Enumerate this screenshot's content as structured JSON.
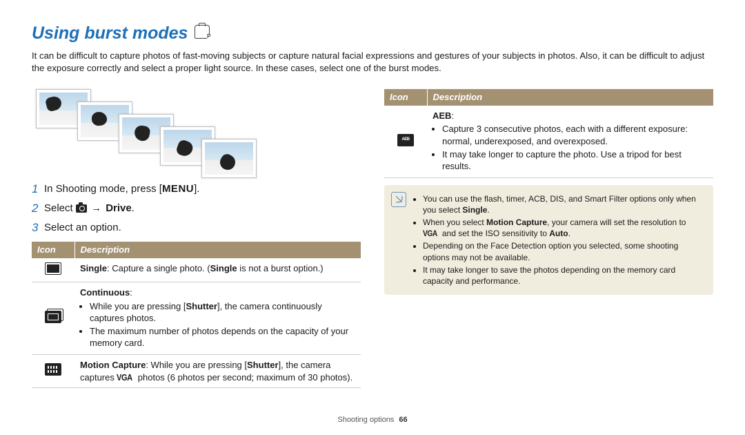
{
  "title": "Using burst modes",
  "intro": "It can be difficult to capture photos of fast-moving subjects or capture natural facial expressions and gestures of your subjects in photos. Also, it can be difficult to adjust the exposure correctly and select a proper light source. In these cases, select one of the burst modes.",
  "steps": {
    "s1_pre": "In Shooting mode, press [",
    "s1_menu": "MENU",
    "s1_post": "].",
    "s2_pre": "Select ",
    "s2_arrow": "→",
    "s2_drive": "Drive",
    "s2_post": ".",
    "s3": "Select an option."
  },
  "table": {
    "head_icon": "Icon",
    "head_desc": "Description",
    "single": {
      "label": "Single",
      "rest": ": Capture a single photo. (",
      "em": "Single",
      "tail": " is not a burst option.)"
    },
    "continuous": {
      "label": "Continuous",
      "b1_pre": "While you are pressing [",
      "b1_shutter": "Shutter",
      "b1_post": "], the camera continuously captures photos.",
      "b2": "The maximum number of photos depends on the capacity of your memory card."
    },
    "motion": {
      "label": "Motion Capture",
      "pre": ": While you are pressing [",
      "shutter": "Shutter",
      "mid": "], the camera captures ",
      "vga": "VGA",
      "post": " photos (6 photos per second; maximum of 30 photos)."
    },
    "aeb": {
      "label": "AEB",
      "b1": "Capture 3 consecutive photos, each with a different exposure: normal, underexposed, and overexposed.",
      "b2": "It may take longer to capture the photo. Use a tripod for best results."
    }
  },
  "note": {
    "n1_pre": "You can use the flash, timer, ACB, DIS, and Smart Filter options only when you select ",
    "n1_single": "Single",
    "n1_post": ".",
    "n2_pre": "When you select ",
    "n2_mc": "Motion Capture",
    "n2_mid": ", your camera will set the resolution to ",
    "n2_vga": "VGA",
    "n2_mid2": " and set the ISO sensitivity to ",
    "n2_auto": "Auto",
    "n2_post": ".",
    "n3": "Depending on the Face Detection option you selected, some shooting options may not be available.",
    "n4": "It may take longer to save the photos depending on the memory card capacity and performance."
  },
  "footer": {
    "section": "Shooting options",
    "page": "66"
  }
}
